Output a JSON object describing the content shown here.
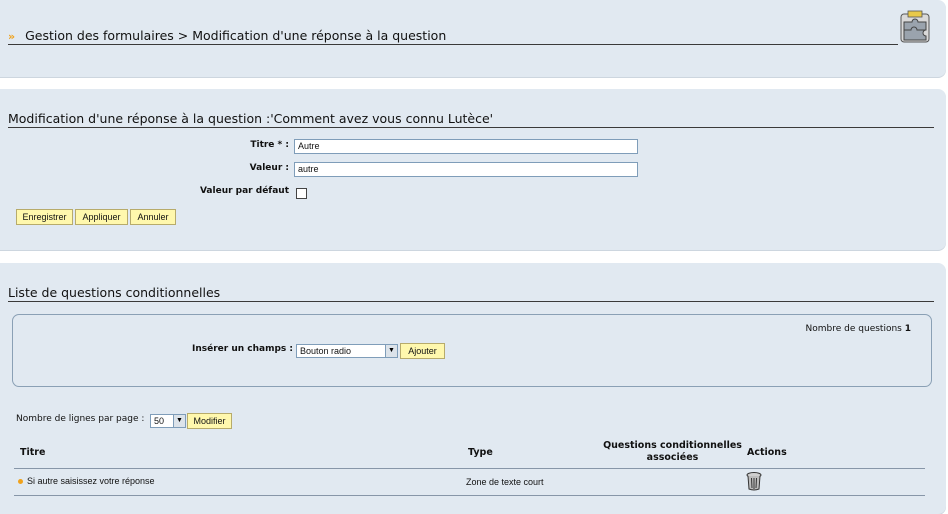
{
  "header": {
    "breadcrumb_root": "Gestion des formulaires",
    "breadcrumb_current": "> Modification d'une réponse à la question",
    "icon": "puzzle-icon"
  },
  "edit_form": {
    "title": "Modification d'une réponse à la question :'Comment avez vous connu Lutèce'",
    "titre_label": "Titre * :",
    "titre_value": "Autre",
    "valeur_label": "Valeur :",
    "valeur_value": "autre",
    "defaut_label": "Valeur par défaut",
    "defaut_checked": false,
    "buttons": {
      "save": "Enregistrer",
      "apply": "Appliquer",
      "cancel": "Annuler"
    }
  },
  "conditional_list": {
    "title": "Liste de questions conditionnelles",
    "count_label": "Nombre de questions",
    "count_value": "1",
    "insert_label": "Insérer un champs :",
    "insert_selected": "Bouton radio",
    "add_button": "Ajouter",
    "rows_per_page_label": "Nombre de lignes par page :",
    "rows_per_page_value": "50",
    "modify_button": "Modifier",
    "columns": {
      "titre": "Titre",
      "type": "Type",
      "conditional_line1": "Questions conditionnelles",
      "conditional_line2": "associées",
      "actions": "Actions"
    },
    "rows": [
      {
        "titre": "Si autre saisissez votre réponse",
        "type": "Zone de texte court",
        "action_icon": "trash-icon"
      }
    ]
  },
  "colors": {
    "panel_bg": "#e1e9f1",
    "button_bg": "#fff8ad",
    "bullet": "#f0a21c"
  }
}
